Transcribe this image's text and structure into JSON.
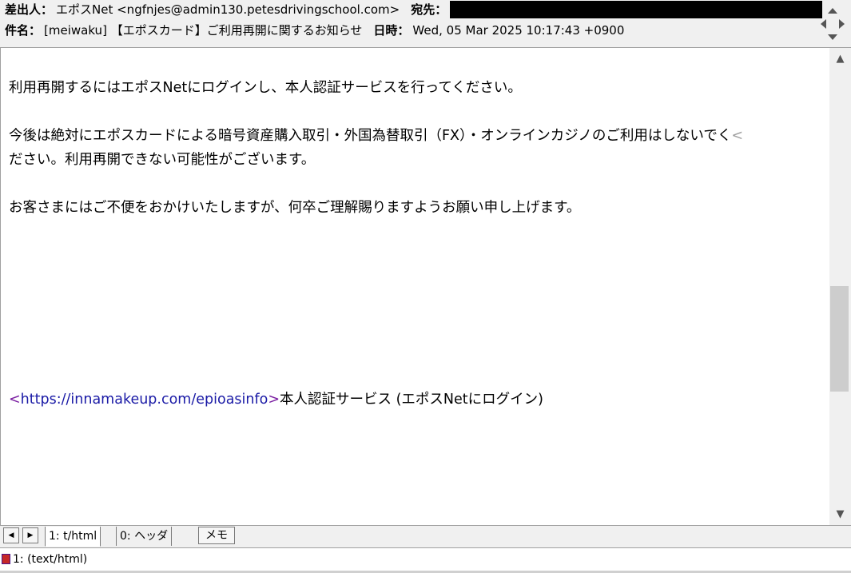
{
  "header": {
    "from_label": "差出人：",
    "from_value": "エポスNet <ngfnjes@admin130.petesdrivingschool.com>",
    "to_label": "宛先：",
    "subject_label": "件名：",
    "subject_value": "[meiwaku] 【エポスカード】ご利用再開に関するお知らせ",
    "date_label": "日時：",
    "date_value": "Wed, 05 Mar 2025 10:17:43 +0900"
  },
  "body": {
    "p1": "利用再開するにはエポスNetにログインし、本人認証サービスを行ってください。",
    "p2a": "今後は絶対にエポスカードによる暗号資産購入取引・外国為替取引（FX）・オンラインカジノのご利用はしないでく",
    "p2a_wrap": "<",
    "p2b": "ださい。利用再開できない可能性がございます。",
    "p3": "お客さまにはご不便をおかけいたしますが、何卒ご理解賜りますようお願い申し上げます。",
    "link_open": "<",
    "link_url": "https://innamakeup.com/epioasinfo",
    "link_close": ">",
    "link_text": "本人認証サービス (エポスNetにログイン)"
  },
  "tabs": {
    "prev": "◀",
    "next": "▶",
    "tab1": "1: t/html",
    "tab2": "0: ヘッダ",
    "memo": "メモ"
  },
  "status": {
    "part": "1: (text/html)"
  },
  "scroll": {
    "up": "▲",
    "down": "▼"
  }
}
